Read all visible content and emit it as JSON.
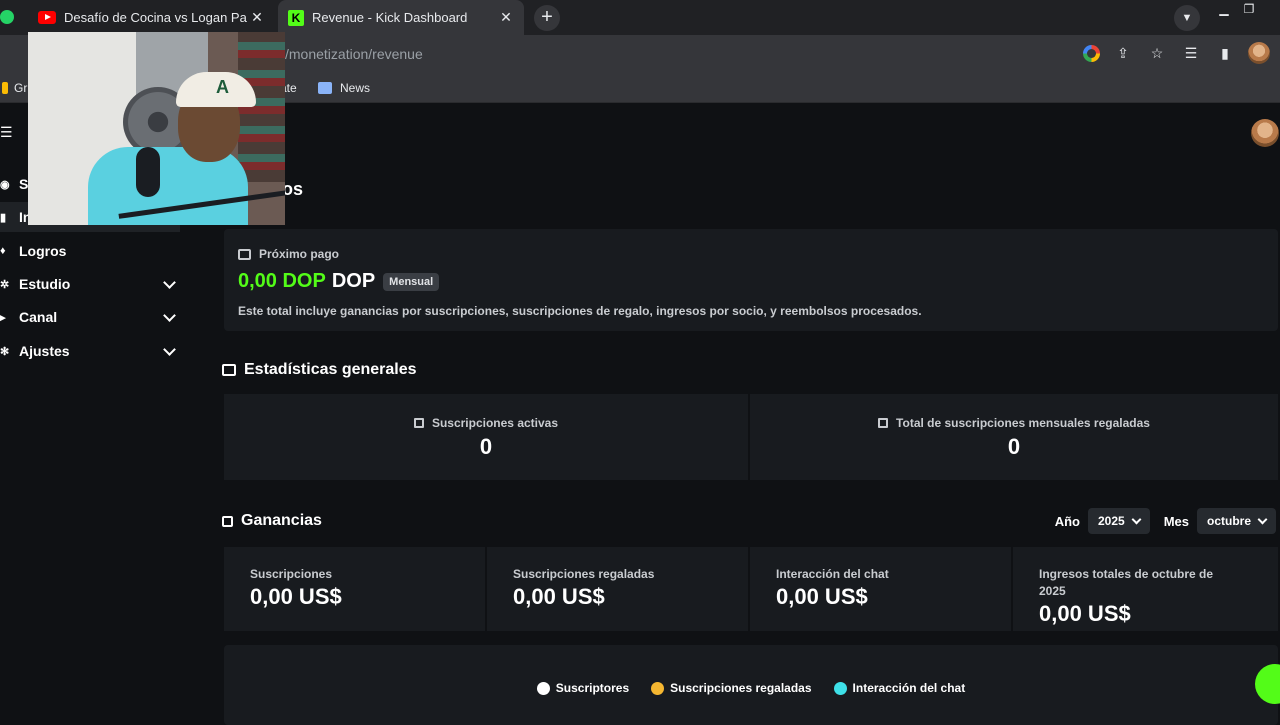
{
  "browser": {
    "tabs": [
      {
        "title": "Desafío de Cocina vs Logan Paul"
      },
      {
        "title": "Revenue - Kick Dashboard"
      }
    ],
    "url": "/monetization/revenue",
    "bookmarks": [
      {
        "label": "Gr"
      },
      {
        "label": "ate"
      },
      {
        "label": "News"
      }
    ]
  },
  "sidebar": {
    "items": [
      {
        "label": "S"
      },
      {
        "label": "In"
      },
      {
        "label": "Logros"
      },
      {
        "label": "Estudio"
      },
      {
        "label": "Canal"
      },
      {
        "label": "Ajustes"
      }
    ]
  },
  "main": {
    "title_visible": "os",
    "payout": {
      "label": "Próximo pago",
      "amount": "0,00 DOP",
      "currency": "DOP",
      "badge": "Mensual",
      "note": "Este total incluye ganancias por suscripciones, suscripciones de regalo, ingresos por socio, y reembolsos procesados."
    },
    "stats": {
      "heading": "Estadísticas generales",
      "cards": [
        {
          "label": "Suscripciones activas",
          "value": "0"
        },
        {
          "label": "Total de suscripciones mensuales regaladas",
          "value": "0"
        }
      ]
    },
    "earnings": {
      "heading": "Ganancias",
      "year_label": "Año",
      "year_value": "2025",
      "month_label": "Mes",
      "month_value": "octubre",
      "cards": [
        {
          "label": "Suscripciones",
          "value": "0,00 US$"
        },
        {
          "label": "Suscripciones regaladas",
          "value": "0,00 US$"
        },
        {
          "label": "Interacción del chat",
          "value": "0,00 US$"
        },
        {
          "label": "Ingresos totales de octubre de 2025",
          "value": "0,00 US$"
        }
      ]
    },
    "legend": [
      {
        "label": "Suscriptores",
        "color": "#ffffff"
      },
      {
        "label": "Suscripciones regaladas",
        "color": "#f5b731"
      },
      {
        "label": "Interacción del chat",
        "color": "#3ee0e8"
      }
    ]
  },
  "colors": {
    "accent": "#53fc18",
    "card": "#181b1f",
    "background": "#0f1114"
  }
}
